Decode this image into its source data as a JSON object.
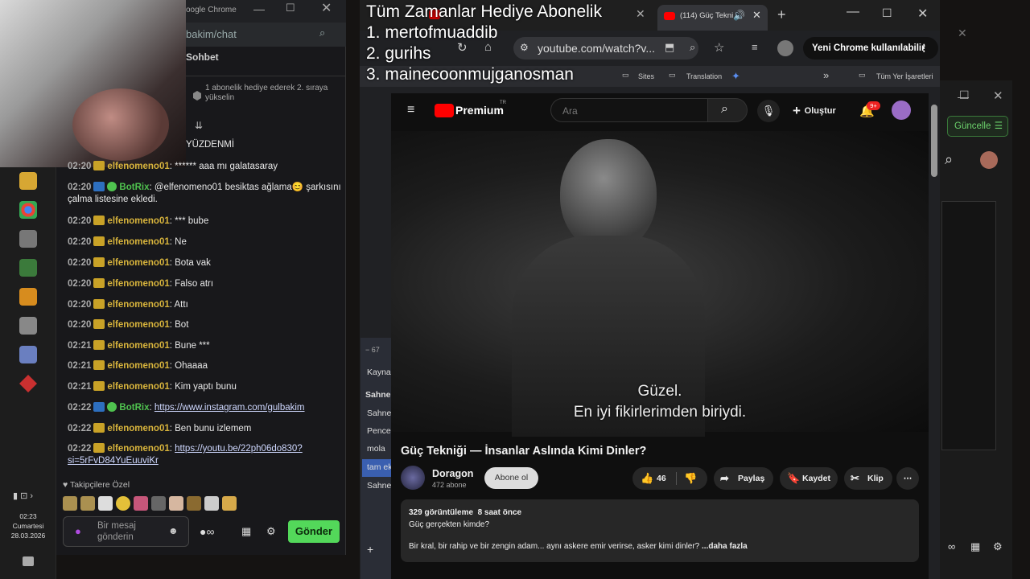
{
  "overlay": {
    "heading": "Tüm Zamanlar Hediye Abonelik",
    "lines": [
      "1. mertofmuaddib",
      "2. gurihs",
      "3. mainecoonmujganosman"
    ]
  },
  "chat": {
    "window_title": "oogle Chrome",
    "url": "bakim/chat",
    "header": "Sohbet",
    "notice": "1 abonelik hediye ederek 2. sıraya yükselin",
    "partial_line": "YÜZDENMİ",
    "messages": [
      {
        "time": "02:20",
        "user": "elfenomeno01",
        "text": "****** aaa mı galatasaray",
        "bot": false
      },
      {
        "time": "02:20",
        "user": "BotRix",
        "text": "@elfenomeno01 besiktas ağlama😊 şarkısını çalma listesine ekledi.",
        "bot": true
      },
      {
        "time": "02:20",
        "user": "elfenomeno01",
        "text": "*** bube",
        "bot": false
      },
      {
        "time": "02:20",
        "user": "elfenomeno01",
        "text": "Ne",
        "bot": false
      },
      {
        "time": "02:20",
        "user": "elfenomeno01",
        "text": "Bota vak",
        "bot": false
      },
      {
        "time": "02:20",
        "user": "elfenomeno01",
        "text": "Falso atrı",
        "bot": false
      },
      {
        "time": "02:20",
        "user": "elfenomeno01",
        "text": "Attı",
        "bot": false
      },
      {
        "time": "02:20",
        "user": "elfenomeno01",
        "text": "Bot",
        "bot": false
      },
      {
        "time": "02:21",
        "user": "elfenomeno01",
        "text": "Bune ***",
        "bot": false
      },
      {
        "time": "02:21",
        "user": "elfenomeno01",
        "text": "Ohaaaa",
        "bot": false
      },
      {
        "time": "02:21",
        "user": "elfenomeno01",
        "text": "Kim yaptı bunu",
        "bot": false
      },
      {
        "time": "02:22",
        "user": "BotRix",
        "link": "https://www.instagram.com/gulbakim",
        "bot": true
      },
      {
        "time": "02:22",
        "user": "elfenomeno01",
        "text": "Ben bunu izlemem",
        "bot": false
      },
      {
        "time": "02:22",
        "user": "elfenomeno01",
        "link": "https://youtu.be/22ph06do830?si=5rFvD84YuEuuviKr",
        "bot": false
      }
    ],
    "followers_label": "Takipçilere Özel",
    "input_placeholder": "Bir mesaj gönderin",
    "send_label": "Gönder"
  },
  "taskbar": {
    "time": "02:23",
    "day": "Cumartesi",
    "date": "28.03.2026"
  },
  "obs": {
    "items": [
      "Kaynal",
      "Sahnel",
      "Sahne",
      "Pencer",
      "mola",
      "tam ek",
      "Sahne"
    ],
    "zoom": "67"
  },
  "browser": {
    "tab_title": "(114) Güç Tekni",
    "url": "youtube.com/watch?v...",
    "profile_button": "Yeni Chrome kullanılabilir",
    "bookmarks": [
      "Sites",
      "Translation",
      "Tüm Yer İşaretleri"
    ]
  },
  "youtube": {
    "logo": "Premium",
    "region": "TR",
    "search_placeholder": "Ara",
    "create_label": "Oluştur",
    "notif_count": "9+",
    "subtitle_line1": "Güzel.",
    "subtitle_line2": "En iyi fikirlerimden biriydi.",
    "video_title": "Güç Tekniği — İnsanlar Aslında Kimi Dinler?",
    "channel": "Doragon",
    "subscribers": "472 abone",
    "subscribe_label": "Abone ol",
    "likes": "46",
    "share_label": "Paylaş",
    "save_label": "Kaydet",
    "clip_label": "Klip",
    "views": "329 görüntüleme",
    "published": "8 saat önce",
    "desc_line1": "Güç gerçekten kimde?",
    "desc_line2": "Bir kral, bir rahip ve bir zengin adam... aynı askere emir verirse, asker kimi dinler?",
    "more_label": "...daha fazla"
  },
  "side": {
    "update_label": "Güncelle"
  }
}
